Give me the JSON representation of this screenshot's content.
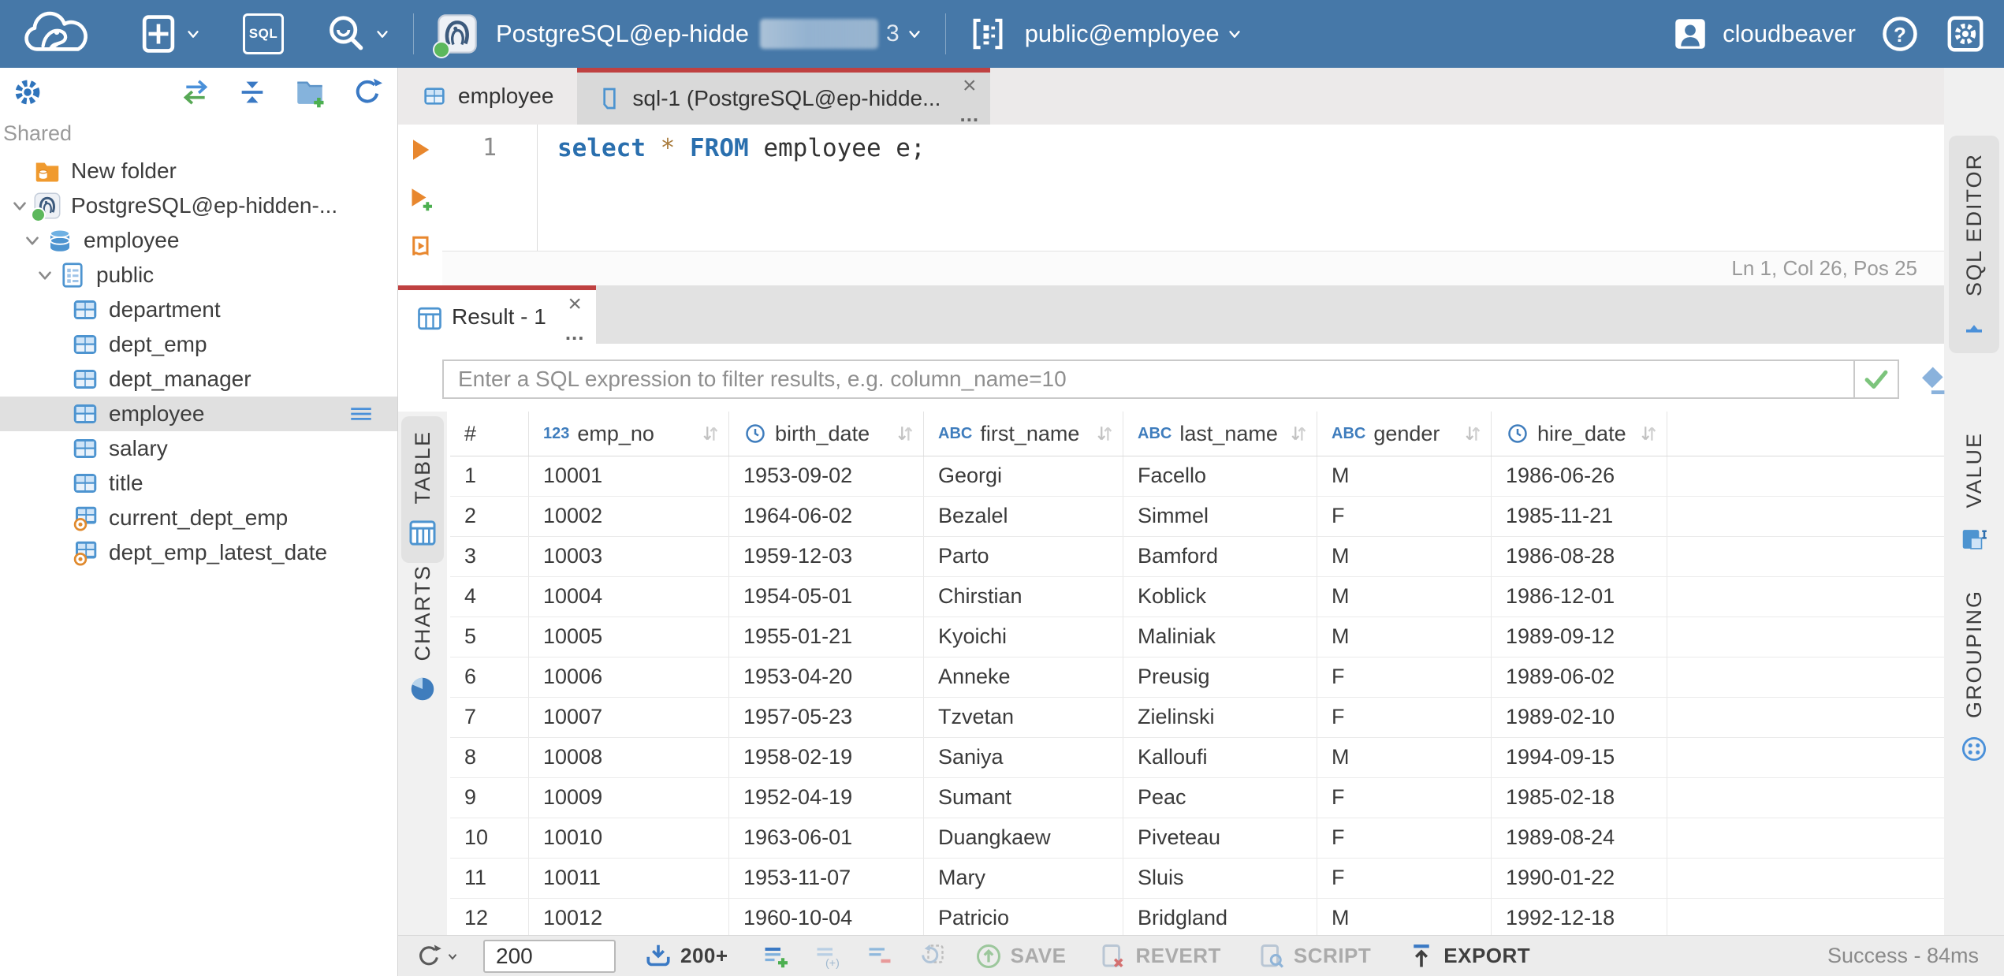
{
  "colors": {
    "topbar": "#4678a8",
    "accent_blue": "#4d94d0",
    "tab_active_border": "#bf4141",
    "orange": "#e8872e",
    "success_green": "#7cc47c"
  },
  "topbar": {
    "sql_button": "SQL",
    "connection_name": "PostgreSQL@ep-hidde",
    "connection_suffix": "3",
    "schema_selector": "public@employee",
    "username": "cloudbeaver",
    "help_glyph": "?"
  },
  "sidebar": {
    "section_label": "Shared",
    "tree": [
      {
        "label": "New folder",
        "icon": "folderdb",
        "depth": 0,
        "chevron": false
      },
      {
        "label": "PostgreSQL@ep-hidden-...",
        "icon": "postgres",
        "depth": 0,
        "chevron": true
      },
      {
        "label": "employee",
        "icon": "database",
        "depth": 1,
        "chevron": true
      },
      {
        "label": "public",
        "icon": "schema",
        "depth": 2,
        "chevron": true
      },
      {
        "label": "department",
        "icon": "table",
        "depth": 3,
        "chevron": false
      },
      {
        "label": "dept_emp",
        "icon": "table",
        "depth": 3,
        "chevron": false
      },
      {
        "label": "dept_manager",
        "icon": "table",
        "depth": 3,
        "chevron": false
      },
      {
        "label": "employee",
        "icon": "table",
        "depth": 3,
        "chevron": false,
        "selected": true
      },
      {
        "label": "salary",
        "icon": "table",
        "depth": 3,
        "chevron": false
      },
      {
        "label": "title",
        "icon": "table",
        "depth": 3,
        "chevron": false
      },
      {
        "label": "current_dept_emp",
        "icon": "view",
        "depth": 3,
        "chevron": false
      },
      {
        "label": "dept_emp_latest_date",
        "icon": "view",
        "depth": 3,
        "chevron": false
      }
    ]
  },
  "editor_tabs": {
    "tab_employee": "employee",
    "tab_sql": "sql-1 (PostgreSQL@ep-hidde...",
    "close_glyph": "×",
    "more_glyph": "..."
  },
  "editor": {
    "line_number": "1",
    "code": {
      "keyword1": "select",
      "star": "*",
      "keyword2": "FROM",
      "rest": "employee e;"
    },
    "status_position": "Ln 1, Col 26, Pos 25",
    "panel_tab": "SQL EDITOR"
  },
  "results": {
    "tab_label": "Result - 1",
    "close_glyph": "×",
    "more_glyph": "...",
    "filter_placeholder": "Enter a SQL expression to filter results, e.g. column_name=10",
    "left_tabs": [
      "TABLE",
      "CHARTS"
    ],
    "right_tabs": [
      "VALUE",
      "GROUPING"
    ],
    "grid": {
      "columns": [
        {
          "label": "#",
          "badge": null,
          "icon": null,
          "sortable": false
        },
        {
          "label": "emp_no",
          "badge": "123",
          "icon": null,
          "sortable": true
        },
        {
          "label": "birth_date",
          "badge": null,
          "icon": "clock",
          "sortable": true
        },
        {
          "label": "first_name",
          "badge": "ABC",
          "icon": null,
          "sortable": true
        },
        {
          "label": "last_name",
          "badge": "ABC",
          "icon": null,
          "sortable": true
        },
        {
          "label": "gender",
          "badge": "ABC",
          "icon": null,
          "sortable": true
        },
        {
          "label": "hire_date",
          "badge": null,
          "icon": "clock",
          "sortable": true
        }
      ],
      "rows": [
        [
          "1",
          "10001",
          "1953-09-02",
          "Georgi",
          "Facello",
          "M",
          "1986-06-26"
        ],
        [
          "2",
          "10002",
          "1964-06-02",
          "Bezalel",
          "Simmel",
          "F",
          "1985-11-21"
        ],
        [
          "3",
          "10003",
          "1959-12-03",
          "Parto",
          "Bamford",
          "M",
          "1986-08-28"
        ],
        [
          "4",
          "10004",
          "1954-05-01",
          "Chirstian",
          "Koblick",
          "M",
          "1986-12-01"
        ],
        [
          "5",
          "10005",
          "1955-01-21",
          "Kyoichi",
          "Maliniak",
          "M",
          "1989-09-12"
        ],
        [
          "6",
          "10006",
          "1953-04-20",
          "Anneke",
          "Preusig",
          "F",
          "1989-06-02"
        ],
        [
          "7",
          "10007",
          "1957-05-23",
          "Tzvetan",
          "Zielinski",
          "F",
          "1989-02-10"
        ],
        [
          "8",
          "10008",
          "1958-02-19",
          "Saniya",
          "Kalloufi",
          "M",
          "1994-09-15"
        ],
        [
          "9",
          "10009",
          "1952-04-19",
          "Sumant",
          "Peac",
          "F",
          "1985-02-18"
        ],
        [
          "10",
          "10010",
          "1963-06-01",
          "Duangkaew",
          "Piveteau",
          "F",
          "1989-08-24"
        ],
        [
          "11",
          "10011",
          "1953-11-07",
          "Mary",
          "Sluis",
          "F",
          "1990-01-22"
        ],
        [
          "12",
          "10012",
          "1960-10-04",
          "Patricio",
          "Bridgland",
          "M",
          "1992-12-18"
        ]
      ]
    },
    "toolbar": {
      "fetch_size": "200",
      "fetch_more_label": "200+",
      "save_label": "SAVE",
      "revert_label": "REVERT",
      "script_label": "SCRIPT",
      "export_label": "EXPORT",
      "status": "Success - 84ms"
    }
  }
}
